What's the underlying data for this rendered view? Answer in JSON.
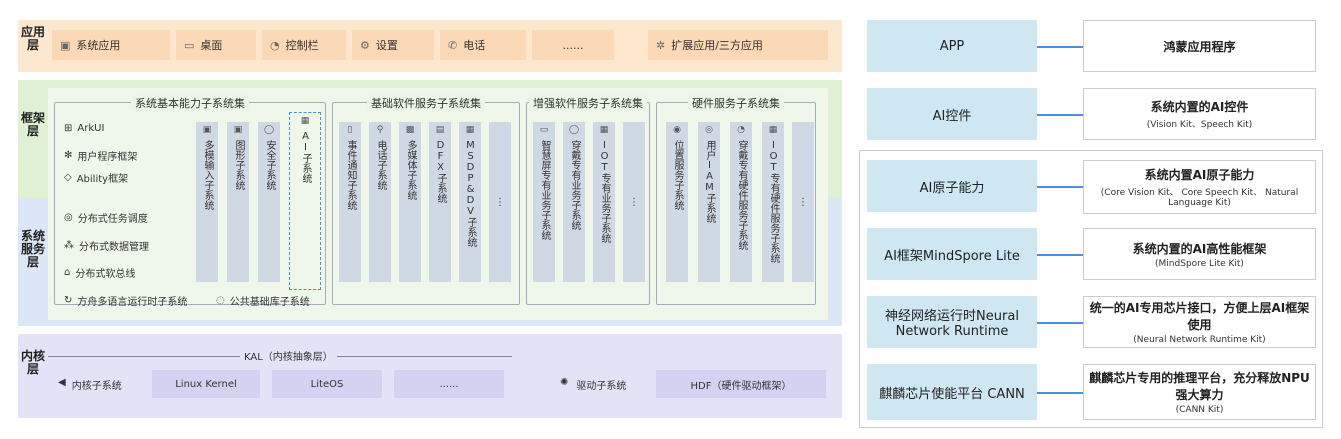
{
  "layers": {
    "app": "应用层",
    "framework": "框架层",
    "services": "系统服务层",
    "kernel": "内核层"
  },
  "app_items": [
    "系统应用",
    "桌面",
    "控制栏",
    "设置",
    "电话",
    "......",
    "扩展应用/三方应用"
  ],
  "groups": {
    "basic": "系统基本能力子系统集",
    "basic_soft": "基础软件服务子系统集",
    "enhanced": "增强软件服务子系统集",
    "hardware": "硬件服务子系统集"
  },
  "framework_items": [
    "ArkUI",
    "用户程序框架",
    "Ability框架"
  ],
  "service_items": [
    "分布式任务调度",
    "分布式数据管理",
    "分布式软总线",
    "方舟多语言运行时子系统",
    "公共基础库子系统"
  ],
  "basic_cols": [
    "多模输入子系统",
    "图形子系统",
    "安全子系统",
    "AI子系统"
  ],
  "basic_soft_cols": [
    "事件通知子系统",
    "电话子系统",
    "多媒体子系统",
    "DFX子系统",
    "MSDP&DV子系统",
    "⋮"
  ],
  "enhanced_cols": [
    "智慧屏专有业务子系统",
    "穿戴专有业务子系统",
    "IOT专有业务子系统",
    "⋮"
  ],
  "hardware_cols": [
    "位置服务子系统",
    "用户IAM子系统",
    "穿戴专有硬件服务子系统",
    "IOT专有硬件服务子系统",
    "⋮"
  ],
  "kernel": {
    "kal": "KAL（内核抽象层）",
    "kernel_sub": "内核子系统",
    "linux": "Linux Kernel",
    "liteos": "LiteOS",
    "more": "......",
    "driver": "驱动子系统",
    "hdf": "HDF（硬件驱动框架）"
  },
  "right": [
    {
      "left": "APP",
      "title": "鸿蒙应用程序",
      "sub": ""
    },
    {
      "left": "AI控件",
      "title": "系统内置的AI控件",
      "sub": "(Vision Kit、Speech Kit)"
    },
    {
      "left": "AI原子能力",
      "title": "系统内置AI原子能力",
      "sub": "(Core Vision Kit、 Core Speech Kit、 Natural Language Kit)"
    },
    {
      "left": "AI框架MindSpore Lite",
      "title": "系统内置的AI高性能框架",
      "sub": "(MindSpore Lite Kit)"
    },
    {
      "left": "神经网络运行时Neural Network Runtime",
      "title": "统一的AI专用芯片接口，方便上层AI框架使用",
      "sub": "(Neural Network Runtime Kit)"
    },
    {
      "left": "麒麟芯片使能平台 CANN",
      "title": "麒麟芯片专用的推理平台，充分释放NPU强大算力",
      "sub": "(CANN Kit)"
    }
  ],
  "colors": {
    "app": "#fde7cf",
    "framework": "#dff1d2",
    "services": "#dbe6f7",
    "kernel": "#e3e2f6",
    "accent": "#4a90d9",
    "right_left_box": "#cfe7f3"
  }
}
